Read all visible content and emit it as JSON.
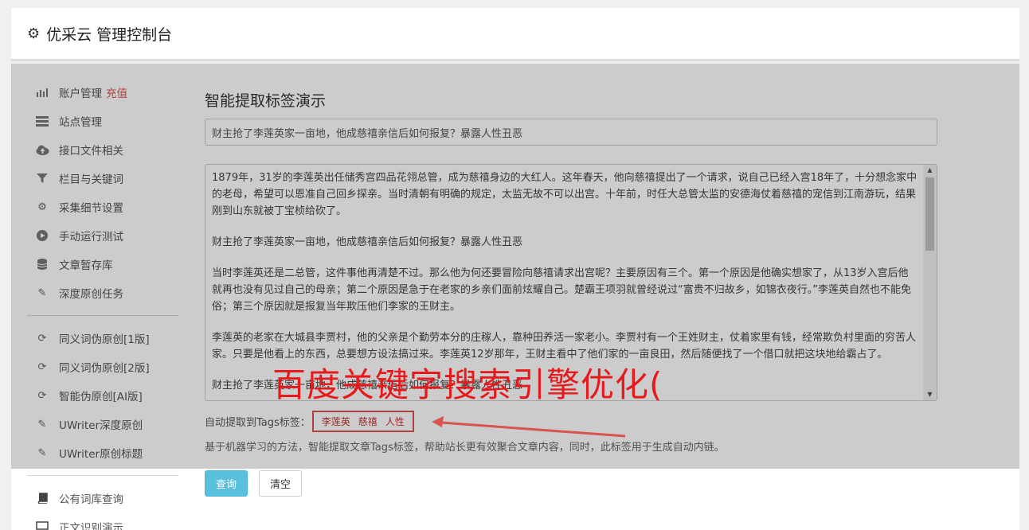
{
  "header": {
    "title": "优采云 管理控制台"
  },
  "sidebar": {
    "group1": [
      {
        "label": "账户管理",
        "badge": "充值",
        "icon": "bar-chart-icon"
      },
      {
        "label": "站点管理",
        "icon": "list-icon"
      },
      {
        "label": "接口文件相关",
        "icon": "cloud-upload-icon"
      },
      {
        "label": "栏目与关键词",
        "icon": "filter-icon"
      },
      {
        "label": "采集细节设置",
        "icon": "cogs-icon"
      },
      {
        "label": "手动运行测试",
        "icon": "play-icon"
      },
      {
        "label": "文章暂存库",
        "icon": "database-icon"
      },
      {
        "label": "深度原创任务",
        "icon": "edit-icon"
      }
    ],
    "group2": [
      {
        "label": "同义词伪原创[1版]",
        "icon": "refresh-icon"
      },
      {
        "label": "同义词伪原创[2版]",
        "icon": "refresh-icon"
      },
      {
        "label": "智能伪原创[AI版]",
        "icon": "refresh-icon"
      },
      {
        "label": "UWriter深度原创",
        "icon": "edit-icon"
      },
      {
        "label": "UWriter原创标题",
        "icon": "edit-icon"
      }
    ],
    "group3": [
      {
        "label": "公有词库查询",
        "icon": "book-icon"
      },
      {
        "label": "正文识别演示",
        "icon": "monitor-icon"
      }
    ]
  },
  "main": {
    "page_title": "智能提取标签演示",
    "title_input_value": "财主抢了李莲英家一亩地，他成慈禧亲信后如何报复？暴露人性丑恶",
    "article_paragraphs": [
      "1879年，31岁的李莲英出任储秀宫四品花翎总管，成为慈禧身边的大红人。这年春天，他向慈禧提出了一个请求，说自己已经入宫18年了，十分想念家中的老母，希望可以恩准自己回乡探亲。当时清朝有明确的规定，太监无故不可以出宫。十年前，时任大总管太监的安德海仗着慈禧的宠信到江南游玩，结果刚到山东就被丁宝桢给砍了。",
      "财主抢了李莲英家一亩地，他成慈禧亲信后如何报复？暴露人性丑恶",
      "当时李莲英还是二总管，这件事他再清楚不过。那么他为何还要冒险向慈禧请求出宫呢？主要原因有三个。第一个原因是他确实想家了，从13岁入宫后他就再也没有见过自己的母亲；第二个原因是急于在老家的乡亲们面前炫耀自己。楚霸王项羽就曾经说过“富贵不归故乡，如锦衣夜行。”李莲英自然也不能免俗；第三个原因就是报复当年欺压他们李家的王财主。",
      "李莲英的老家在大城县李贾村，他的父亲是个勤劳本分的庄稼人，靠种田养活一家老小。李贾村有一个王姓财主，仗着家里有钱，经常欺负村里面的穷苦人家。只要是他看上的东西，总要想方设法搞过来。李莲英12岁那年，王财主看中了他们家的一亩良田，然后随便找了一个借口就把这块地给霸占了。",
      "财主抢了李莲英家一亩地，他成慈禧亲信后如何报复？暴露人性丑恶"
    ],
    "tags_label": "自动提取到Tags标签：",
    "tags": [
      "李莲英",
      "慈禧",
      "人性"
    ],
    "description": "基于机器学习的方法，智能提取文章Tags标签，帮助站长更有效聚合文章内容，同时，此标签用于生成自动内链。",
    "query_button": "查询",
    "clear_button": "清空"
  },
  "watermark": {
    "text": "百度关键字搜索引擎优化("
  },
  "colors": {
    "accent": "#5bc0de",
    "tag_red": "#d9534f",
    "watermark_red": "#e8191d"
  }
}
